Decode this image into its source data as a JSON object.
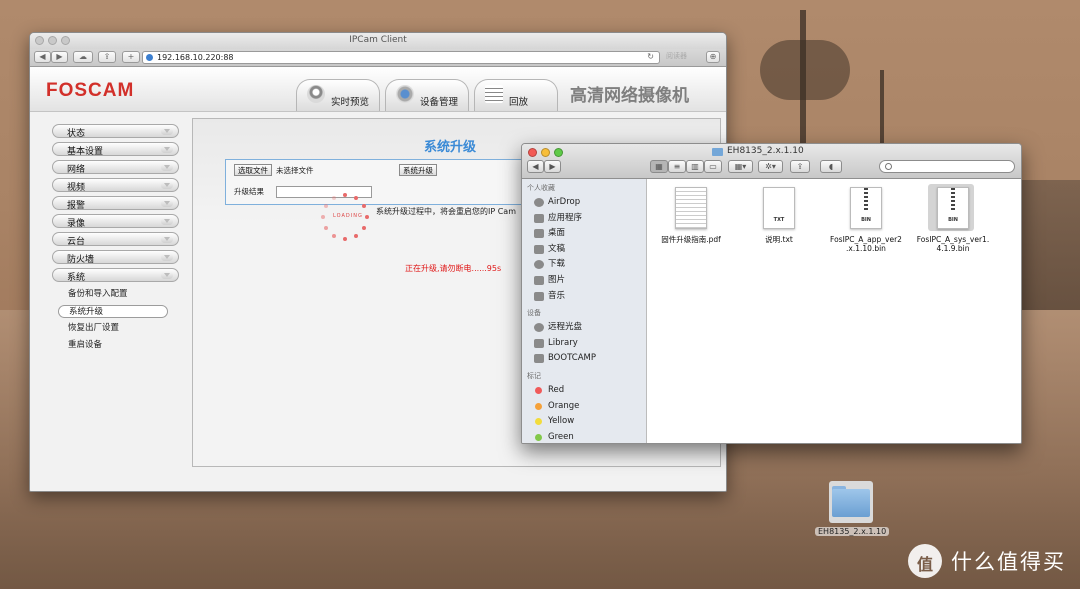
{
  "browser": {
    "window_title": "IPCam Client",
    "url": "192.168.10.220:88",
    "reader_label": "阅读器"
  },
  "app": {
    "logo": "FOSCAM",
    "header_title": "高清网络摄像机",
    "nav_tabs": [
      {
        "label": "实时预览",
        "icon": "camera-icon"
      },
      {
        "label": "设备管理",
        "icon": "gears-icon"
      },
      {
        "label": "回放",
        "icon": "calendar-icon"
      }
    ],
    "sidebar": {
      "items": [
        "状态",
        "基本设置",
        "网络",
        "视频",
        "报警",
        "录像",
        "云台",
        "防火墙",
        "系统"
      ],
      "sub_items": [
        "备份和导入配置",
        "系统升级",
        "恢复出厂设置",
        "重启设备"
      ],
      "active_sub": "系统升级"
    },
    "panel": {
      "title": "系统升级",
      "choose_file_button": "选取文件",
      "no_file_text": "未选择文件",
      "upgrade_button": "系统升级",
      "result_label": "升级结果",
      "spinner_text": "LOADING",
      "loading_note": "系统升级过程中，将会重启您的IP Cam",
      "progress_note": "正在升级,请勿断电......95s"
    }
  },
  "finder": {
    "title": "EH8135_2.x.1.10",
    "sections": [
      {
        "header": "个人收藏",
        "rows": [
          {
            "label": "AirDrop",
            "icon": "airdrop-icon"
          },
          {
            "label": "应用程序",
            "icon": "applications-icon"
          },
          {
            "label": "桌面",
            "icon": "desktop-icon"
          },
          {
            "label": "文稿",
            "icon": "documents-icon"
          },
          {
            "label": "下载",
            "icon": "downloads-icon"
          },
          {
            "label": "图片",
            "icon": "pictures-icon"
          },
          {
            "label": "音乐",
            "icon": "music-icon"
          }
        ]
      },
      {
        "header": "设备",
        "rows": [
          {
            "label": "远程光盘",
            "icon": "remote-disc-icon"
          },
          {
            "label": "Library",
            "icon": "drive-icon"
          },
          {
            "label": "BOOTCAMP",
            "icon": "drive-icon"
          }
        ]
      },
      {
        "header": "标记",
        "rows": [
          {
            "label": "Red",
            "color": "#f05a5a"
          },
          {
            "label": "Orange",
            "color": "#f5a13a"
          },
          {
            "label": "Yellow",
            "color": "#f2dc3c"
          },
          {
            "label": "Green",
            "color": "#82c84a"
          }
        ]
      }
    ],
    "files": [
      {
        "name": "固件升级指南.pdf",
        "tag": "",
        "selected": false
      },
      {
        "name": "说明.txt",
        "tag": "TXT",
        "selected": false
      },
      {
        "name": "FosIPC_A_app_ver2.x.1.10.bin",
        "name_line1": "FosIPC_A_app_ver2",
        "name_line2": ".x.1.10.bin",
        "tag": "BIN",
        "selected": false
      },
      {
        "name": "FosIPC_A_sys_ver1.4.1.9.bin",
        "name_line1": "FosIPC_A_sys_ver1.",
        "name_line2": "4.1.9.bin",
        "tag": "BIN",
        "selected": true
      }
    ]
  },
  "desktop": {
    "folder_label": "EH8135_2.x.1.10",
    "watermark": "什么值得买"
  },
  "colors": {
    "foscam_red": "#d2302a",
    "panel_title_blue": "#3a8ad6",
    "progress_red": "#e01818",
    "finder_selection": "#3b74d4"
  }
}
